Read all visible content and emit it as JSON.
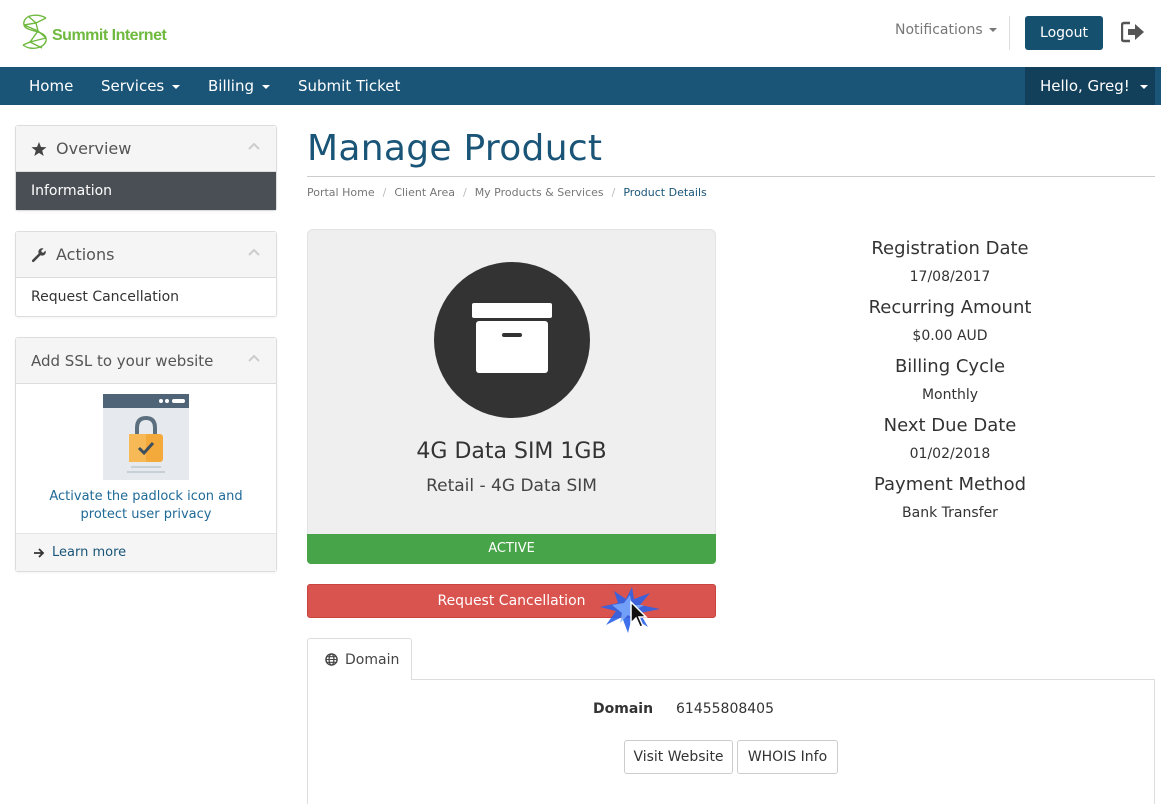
{
  "header": {
    "logo_text": "Summit Internet",
    "notifications_label": "Notifications",
    "logout_label": "Logout"
  },
  "nav": {
    "items": [
      "Home",
      "Services",
      "Billing",
      "Submit Ticket"
    ],
    "user_label": "Hello, Greg!"
  },
  "sidebar": {
    "overview": {
      "title": "Overview",
      "items": [
        "Information"
      ]
    },
    "actions": {
      "title": "Actions",
      "items": [
        "Request Cancellation"
      ]
    },
    "ssl": {
      "title": "Add SSL to your website",
      "text": "Activate the padlock icon and protect user privacy",
      "link": "Learn more"
    }
  },
  "main": {
    "title": "Manage Product",
    "breadcrumb": [
      "Portal Home",
      "Client Area",
      "My Products & Services",
      "Product Details"
    ],
    "product": {
      "name": "4G Data SIM 1GB",
      "group": "Retail - 4G Data SIM",
      "status": "ACTIVE"
    },
    "cancel_button": "Request Cancellation",
    "info": [
      {
        "label": "Registration Date",
        "value": "17/08/2017"
      },
      {
        "label": "Recurring Amount",
        "value": "$0.00 AUD"
      },
      {
        "label": "Billing Cycle",
        "value": "Monthly"
      },
      {
        "label": "Next Due Date",
        "value": "01/02/2018"
      },
      {
        "label": "Payment Method",
        "value": "Bank Transfer"
      }
    ],
    "tabs": [
      {
        "label": "Domain"
      }
    ],
    "domain": {
      "label": "Domain",
      "value": "61455808405",
      "visit_button": "Visit Website",
      "whois_button": "WHOIS Info"
    }
  },
  "colors": {
    "brand_green": "#6fb93f",
    "nav_blue": "#1a5578",
    "active_green": "#48a448",
    "danger_red": "#d9534f"
  }
}
